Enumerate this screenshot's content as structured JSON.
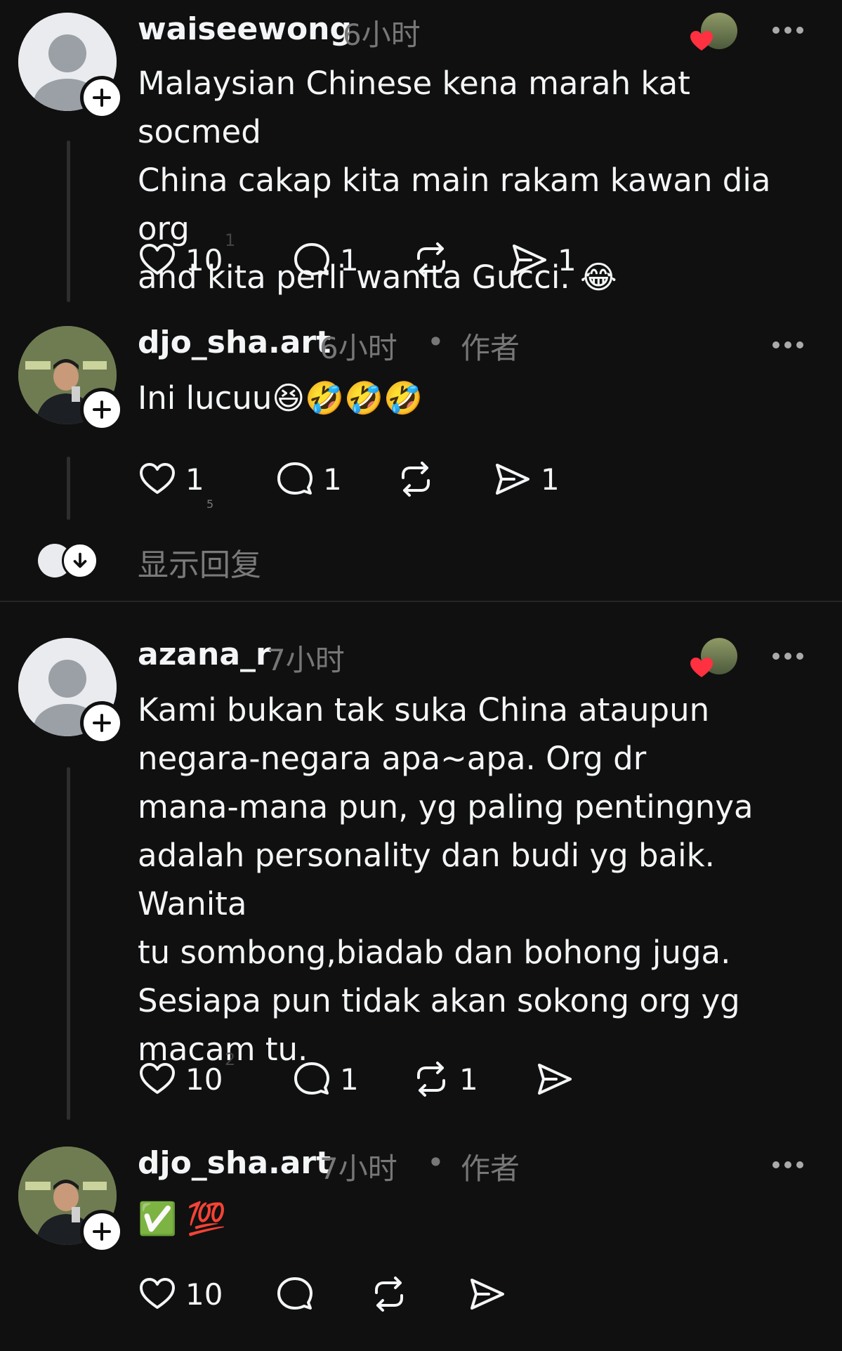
{
  "posts": [
    {
      "username": "waiseewong",
      "time": "6小时",
      "text": "Malaysian Chinese kena marah kat socmed\nChina cakap kita main rakam kawan dia org\nand kita perli wanita Gucci. 😂",
      "likes": "10",
      "likes_sup": "1",
      "comments": "1",
      "reposts": "",
      "shares": "1"
    },
    {
      "username": "djo_sha.art",
      "time": "6小时",
      "separator": "•",
      "author_tag": "作者",
      "text": "Ini lucuu😆🤣🤣🤣",
      "likes": "1",
      "likes_sub": "5",
      "comments": "1",
      "reposts": "",
      "shares": "1"
    },
    {
      "username": "azana_r",
      "time": "7小时",
      "text": "Kami bukan tak suka China ataupun\nnegara-negara apa~apa. Org dr\nmana-mana pun, yg paling pentingnya\nadalah personality dan budi yg baik. Wanita\ntu sombong,biadab dan bohong juga.\nSesiapa pun tidak akan sokong org yg\nmacam tu.",
      "likes": "10",
      "likes_sup": "2",
      "comments": "1",
      "reposts": "1",
      "shares": ""
    },
    {
      "username": "djo_sha.art",
      "time": "7小时",
      "separator": "•",
      "author_tag": "作者",
      "text": "✅ 💯",
      "likes": "10",
      "comments": "",
      "reposts": "",
      "shares": ""
    }
  ],
  "show_replies_label": "显示回复",
  "colors": {
    "background": "#101010",
    "text": "#f3f5f7",
    "muted": "#777777",
    "heart": "#ff3040"
  },
  "icons": [
    "heart-icon",
    "comment-icon",
    "repost-icon",
    "share-icon",
    "more-icon",
    "plus-icon",
    "arrow-down-icon"
  ]
}
